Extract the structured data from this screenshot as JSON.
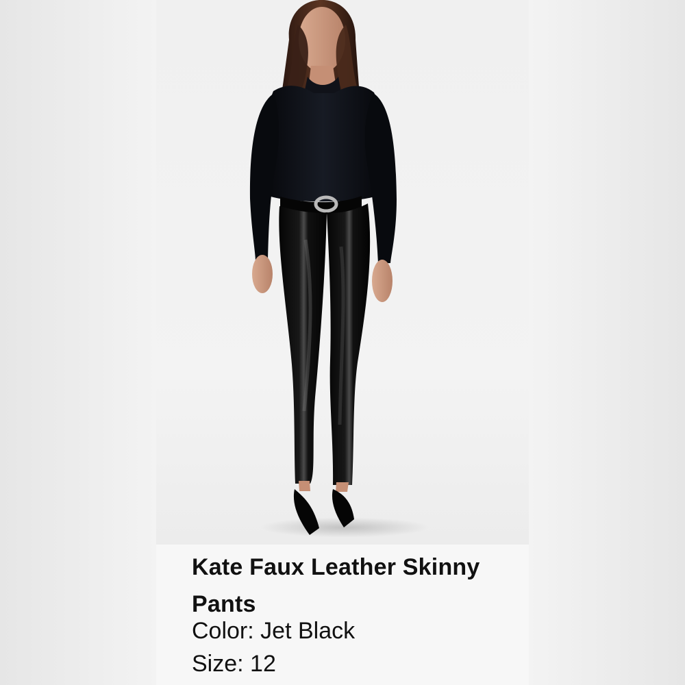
{
  "product": {
    "name": "Kate Faux Leather Skinny Pants",
    "color_label": "Color:",
    "color_value": "Jet Black",
    "size_label": "Size:",
    "size_value": "12"
  },
  "image": {
    "subject": "model wearing black turtleneck top and black faux leather skinny pants with black heels"
  },
  "colors": {
    "background": "#f4f4f4",
    "caption_background": "#f7f7f7",
    "text": "#111111",
    "garment_black": "#0b0d12"
  }
}
